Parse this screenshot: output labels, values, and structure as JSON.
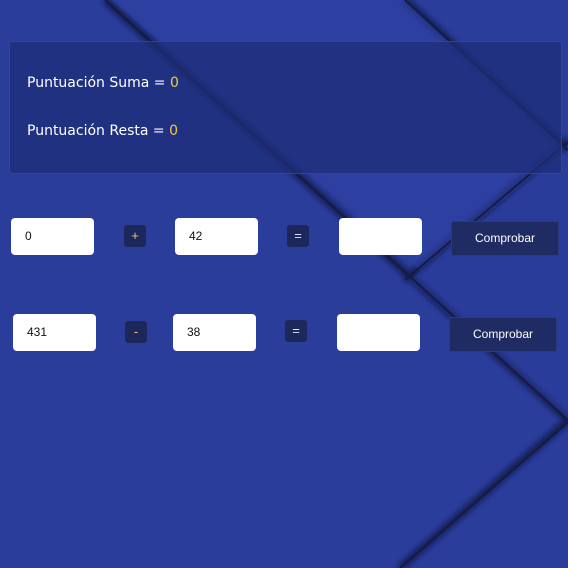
{
  "scores": {
    "sum_label": "Puntuación Suma = ",
    "sum_value": "0",
    "sub_label": "Puntuación Resta = ",
    "sub_value": "0"
  },
  "addition": {
    "operand_a": "0",
    "operator": "+",
    "operand_b": "42",
    "equals": "=",
    "answer": "",
    "check_label": "Comprobar"
  },
  "subtraction": {
    "operand_a": "431",
    "operator": "-",
    "operand_b": "38",
    "equals": "=",
    "answer": "",
    "check_label": "Comprobar"
  },
  "colors": {
    "background": "#2b3d9b",
    "panel": "#1f2e78",
    "score_value": "#f3c94a",
    "button": "#1f2b63"
  }
}
